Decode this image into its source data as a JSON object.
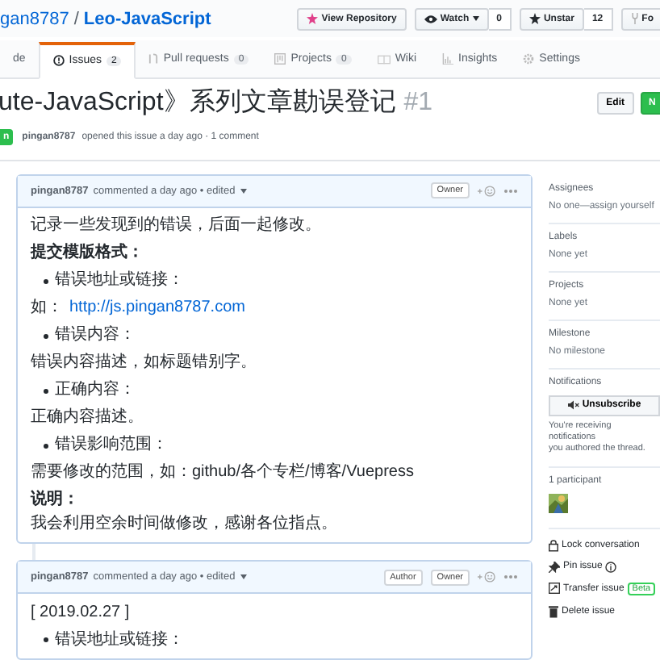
{
  "repo": {
    "owner": "gan8787",
    "separator": "/",
    "name": "Leo-JavaScript"
  },
  "repo_actions": [
    {
      "kind": "view",
      "label": "View Repository"
    },
    {
      "kind": "watch",
      "label": "Watch",
      "count": "0"
    },
    {
      "kind": "star",
      "label": "Unstar",
      "count": "12"
    },
    {
      "kind": "fork",
      "label": "Fo"
    }
  ],
  "tabs": [
    {
      "kind": "code",
      "label": "de",
      "selected": false
    },
    {
      "kind": "issues",
      "label": "Issues",
      "count": "2",
      "selected": true
    },
    {
      "kind": "pulls",
      "label": "Pull requests",
      "count": "0",
      "selected": false
    },
    {
      "kind": "projects",
      "label": "Projects",
      "count": "0",
      "selected": false
    },
    {
      "kind": "wiki",
      "label": "Wiki",
      "selected": false
    },
    {
      "kind": "insights",
      "label": "Insights",
      "selected": false
    },
    {
      "kind": "settings",
      "label": "Settings",
      "selected": false
    }
  ],
  "issue": {
    "title": "ute-JavaScript》系列文章勘误登记",
    "number": "#1",
    "state": "n",
    "author": "pingan8787",
    "meta": "opened this issue a day ago · 1 comment",
    "buttons": [
      {
        "kind": "edit",
        "label": "Edit"
      },
      {
        "kind": "new",
        "label": "N"
      }
    ]
  },
  "comments": [
    {
      "author": "pingan8787",
      "meta": "commented a day ago • edited",
      "badges": [
        "Owner"
      ],
      "body": [
        {
          "kind": "p",
          "text": "记录一些发现到的错误，后面一起修改。"
        },
        {
          "kind": "bold",
          "text": "提交模版格式："
        },
        {
          "kind": "bullet",
          "text": "错误地址或链接："
        },
        {
          "kind": "link",
          "prefix": "如：",
          "link": "http://js.pingan8787.com"
        },
        {
          "kind": "bullet",
          "text": "错误内容："
        },
        {
          "kind": "p",
          "text": "错误内容描述，如标题错别字。"
        },
        {
          "kind": "bullet",
          "text": "正确内容："
        },
        {
          "kind": "p",
          "text": "正确内容描述。"
        },
        {
          "kind": "bullet",
          "text": "错误影响范围："
        },
        {
          "kind": "p",
          "text": "需要修改的范围，如：github/各个专栏/博客/Vuepress"
        },
        {
          "kind": "bold",
          "text": "说明："
        },
        {
          "kind": "tight",
          "text": "我会利用空余时间做修改，感谢各位指点。"
        }
      ]
    },
    {
      "author": "pingan8787",
      "meta": "commented a day ago • edited",
      "badges": [
        "Author",
        "Owner"
      ],
      "body": [
        {
          "kind": "p",
          "text": "[ 2019.02.27 ]"
        },
        {
          "kind": "bullet",
          "text": "错误地址或链接："
        }
      ]
    }
  ],
  "sidebar": {
    "sections": [
      {
        "title": "Assignees",
        "value": "No one—assign yourself"
      },
      {
        "title": "Labels",
        "value": "None yet"
      },
      {
        "title": "Projects",
        "value": "None yet"
      },
      {
        "title": "Milestone",
        "value": "No milestone"
      }
    ],
    "notifications": {
      "title": "Notifications",
      "button": "Unsubscribe",
      "note": "You're receiving notifications",
      "note_2": "you authored the thread."
    },
    "participants": {
      "title": "1 participant"
    },
    "actions": [
      {
        "kind": "lock",
        "label": "Lock conversation"
      },
      {
        "kind": "pin",
        "label": "Pin issue"
      },
      {
        "kind": "transfer",
        "label": "Transfer issue",
        "badge": "Beta"
      },
      {
        "kind": "delete",
        "label": "Delete issue"
      }
    ]
  }
}
